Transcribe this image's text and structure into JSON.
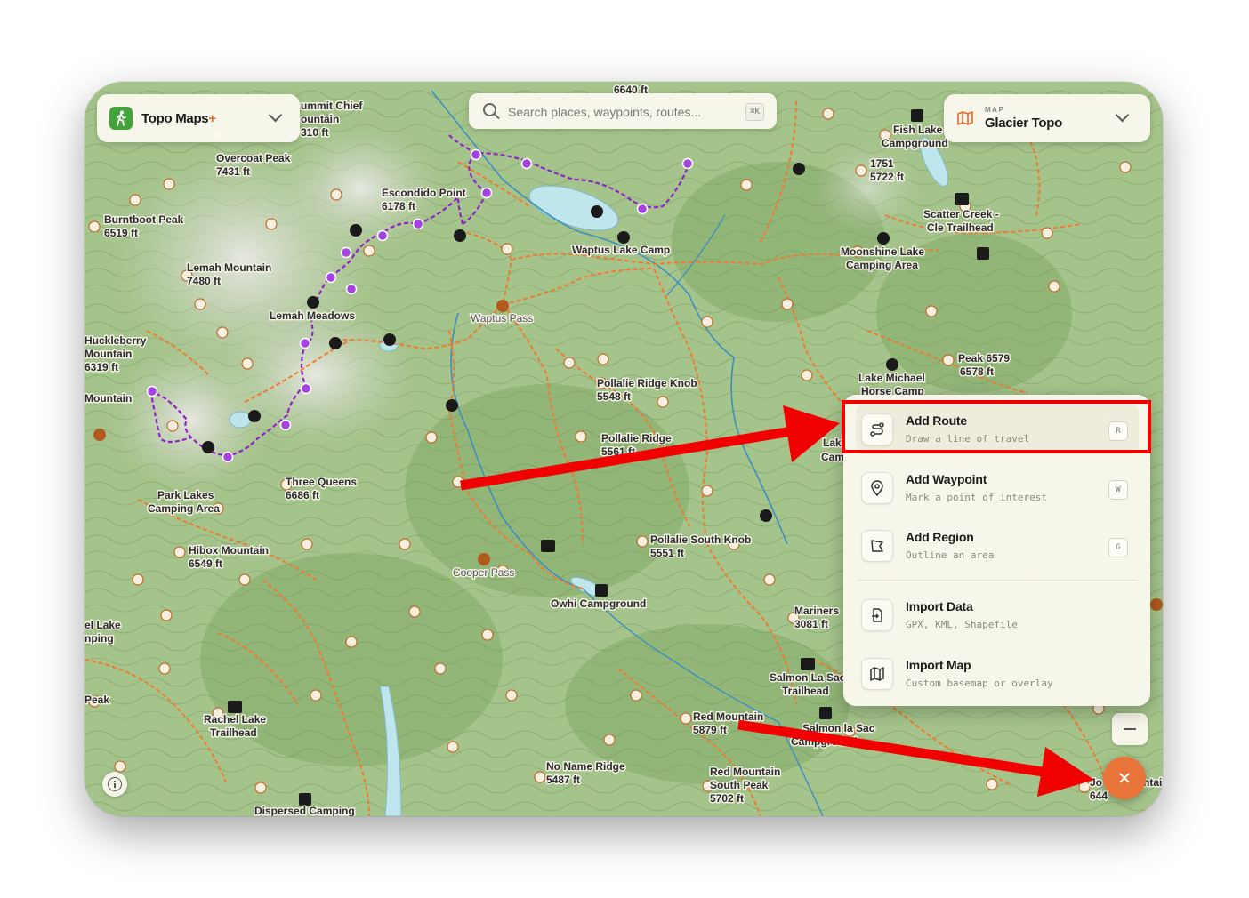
{
  "app": {
    "name": "Topo Maps",
    "plus": "+"
  },
  "search": {
    "placeholder": "Search places, waypoints, routes...",
    "shortcut": "⌘K"
  },
  "map_selector": {
    "caption": "MAP",
    "value": "Glacier Topo"
  },
  "menu": {
    "items": [
      {
        "label": "Add Route",
        "subtitle": "Draw a line of travel",
        "key": "R",
        "icon": "route-icon"
      },
      {
        "label": "Add Waypoint",
        "subtitle": "Mark a point of interest",
        "key": "W",
        "icon": "pin-icon"
      },
      {
        "label": "Add Region",
        "subtitle": "Outline an area",
        "key": "G",
        "icon": "region-icon"
      },
      {
        "label": "Import Data",
        "subtitle": "GPX, KML, Shapefile",
        "icon": "import-icon"
      },
      {
        "label": "Import Map",
        "subtitle": "Custom basemap or overlay",
        "icon": "map-icon"
      }
    ]
  },
  "colors": {
    "accent": "#e8743a",
    "annotation": "#f00000",
    "route": "#8e24c9",
    "trail": "#f07a2e"
  },
  "map_labels": [
    {
      "text": "6640 ft"
    },
    {
      "text": "ummit Chief"
    },
    {
      "text": "ountain"
    },
    {
      "text": "310 ft"
    },
    {
      "text": "Overcoat Peak"
    },
    {
      "text": "7431 ft"
    },
    {
      "text": "Burntboot Peak"
    },
    {
      "text": "6519 ft"
    },
    {
      "text": "Escondido Point"
    },
    {
      "text": "6178 ft"
    },
    {
      "text": "Lemah Mountain"
    },
    {
      "text": "7480 ft"
    },
    {
      "text": "Lemah Meadows"
    },
    {
      "text": "Huckleberry"
    },
    {
      "text": "Mountain"
    },
    {
      "text": "6319 ft"
    },
    {
      "text": "Mountain"
    },
    {
      "text": "Waptus Lake Camp"
    },
    {
      "text": "Waptus Pass"
    },
    {
      "text": "Fish Lake"
    },
    {
      "text": "Campground"
    },
    {
      "text": "1751"
    },
    {
      "text": "5722 ft"
    },
    {
      "text": "Scatter Creek -"
    },
    {
      "text": "Cle Trailhead"
    },
    {
      "text": "Moonshine Lake"
    },
    {
      "text": "Camping Area"
    },
    {
      "text": "Peak 6579"
    },
    {
      "text": "6578 ft"
    },
    {
      "text": "Lake Michael"
    },
    {
      "text": "Horse Camp"
    },
    {
      "text": "Pollalie Ridge Knob"
    },
    {
      "text": "5548 ft"
    },
    {
      "text": "Pollalie Ridge"
    },
    {
      "text": "5561 ft"
    },
    {
      "text": "Three Queens"
    },
    {
      "text": "6686 ft"
    },
    {
      "text": "Park Lakes"
    },
    {
      "text": "Camping Area"
    },
    {
      "text": "Hibox Mountain"
    },
    {
      "text": "6549 ft"
    },
    {
      "text": "Pollalie South Knob"
    },
    {
      "text": "5551 ft"
    },
    {
      "text": "Cooper Pass"
    },
    {
      "text": "Owhi Campground"
    },
    {
      "text": "Mariners"
    },
    {
      "text": "3081 ft"
    },
    {
      "text": "el Lake"
    },
    {
      "text": "nping"
    },
    {
      "text": "Peak"
    },
    {
      "text": "Rachel Lake"
    },
    {
      "text": "Trailhead"
    },
    {
      "text": "Salmon La Sac"
    },
    {
      "text": "Trailhead"
    },
    {
      "text": "Red Mountain"
    },
    {
      "text": "5879 ft"
    },
    {
      "text": "Salmon la Sac"
    },
    {
      "text": "Campground"
    },
    {
      "text": "No Name Ridge"
    },
    {
      "text": "5487 ft"
    },
    {
      "text": "Red Mountain"
    },
    {
      "text": "South Peak"
    },
    {
      "text": "5702 ft"
    },
    {
      "text": "Dispersed Camping"
    },
    {
      "text": "Lak"
    },
    {
      "text": "Cam"
    },
    {
      "text": "Jo"
    },
    {
      "text": "644"
    },
    {
      "text": "ntai"
    }
  ]
}
